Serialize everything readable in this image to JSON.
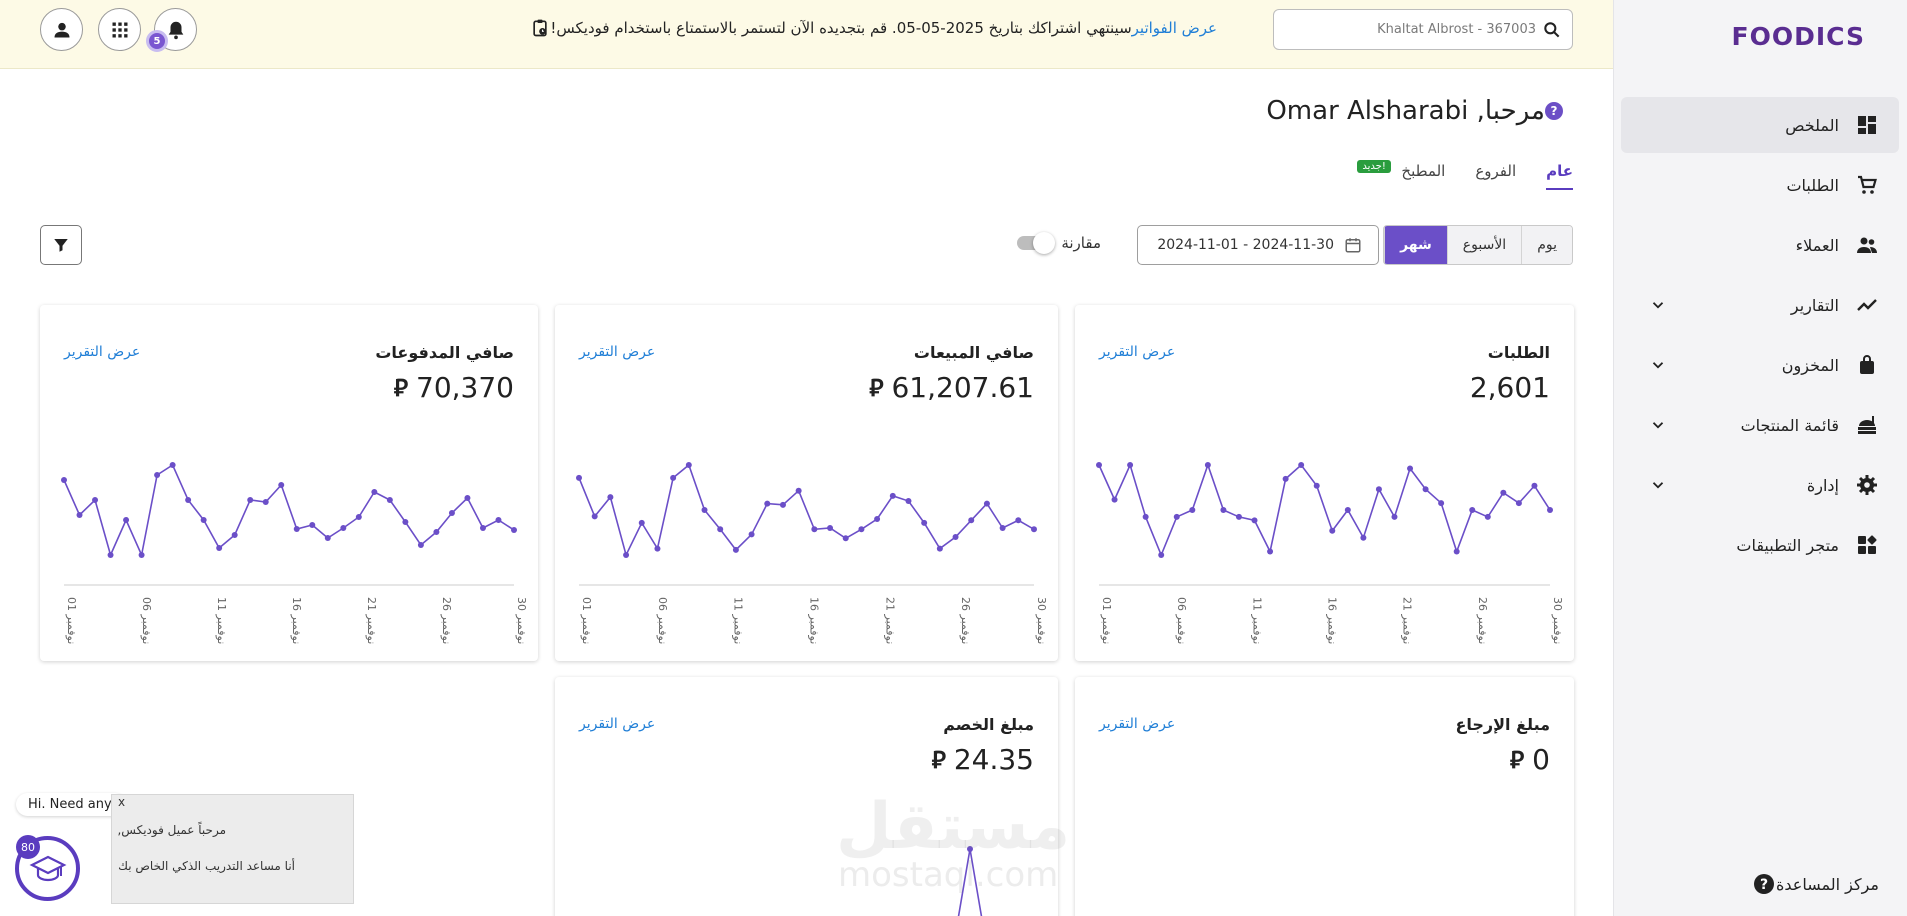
{
  "brand": {
    "logo_text": "FOODICS",
    "accent": "#6b4fc8",
    "link": "#1f7ed6"
  },
  "sidebar": {
    "items": [
      {
        "label": "الملخص",
        "icon": "dashboard-icon",
        "active": true,
        "expandable": false
      },
      {
        "label": "الطلبات",
        "icon": "cart-icon",
        "active": false,
        "expandable": false
      },
      {
        "label": "العملاء",
        "icon": "users-icon",
        "active": false,
        "expandable": false
      },
      {
        "label": "التقارير",
        "icon": "trend-icon",
        "active": false,
        "expandable": true
      },
      {
        "label": "المخزون",
        "icon": "bag-icon",
        "active": false,
        "expandable": true
      },
      {
        "label": "قائمة المنتجات",
        "icon": "food-icon",
        "active": false,
        "expandable": true
      },
      {
        "label": "إدارة",
        "icon": "gear-icon",
        "active": false,
        "expandable": true
      },
      {
        "label": "متجر التطبيقات",
        "icon": "apps-store-icon",
        "active": false,
        "expandable": false
      }
    ],
    "help_center": "مركز المساعدة"
  },
  "topbar": {
    "search_value": "Khaltat Albrost - 367003",
    "notice": "سينتهي اشتراكك بتاريخ 2025-05-05. قم بتجديده الآن لتستمر بالاستمتاع باستخدام فوديكس!",
    "notice_link": "عرض الفواتير",
    "notifications_count": "5"
  },
  "main": {
    "greeting": "مرحبا, Omar Alsharabi",
    "tabs": [
      {
        "label": "عام",
        "active": true
      },
      {
        "label": "الفروع",
        "active": false
      },
      {
        "label": "المطبخ",
        "active": false,
        "badge": "جديد!"
      }
    ],
    "period": {
      "day": "يوم",
      "week": "الأسبوع",
      "month": "شهر",
      "selected": "month"
    },
    "date_range": "2024-11-01 - 2024-11-30",
    "compare_label": "مقارنة",
    "currency_symbol": "⃁",
    "x_ticks": [
      "01 نوفمبر",
      "06 نوفمبر",
      "11 نوفمبر",
      "16 نوفمبر",
      "21 نوفمبر",
      "26 نوفمبر",
      "30 نوفمبر"
    ],
    "view_report": "عرض التقرير",
    "cards": [
      {
        "title": "الطلبات",
        "value": "2,601",
        "currency": false
      },
      {
        "title": "صافي المبيعات",
        "value": "61,207.61",
        "currency": true
      },
      {
        "title": "صافي المدفوعات",
        "value": "70,370",
        "currency": true
      },
      {
        "title": "مبلغ الإرجاع",
        "value": "0",
        "currency": true
      },
      {
        "title": "مبلغ الخصم",
        "value": "24.35",
        "currency": true
      }
    ]
  },
  "chart_data": [
    {
      "type": "line",
      "title": "الطلبات",
      "x": [
        "01",
        "02",
        "03",
        "04",
        "05",
        "06",
        "07",
        "08",
        "09",
        "10",
        "11",
        "12",
        "13",
        "14",
        "15",
        "16",
        "17",
        "18",
        "19",
        "20",
        "21",
        "22",
        "23",
        "24",
        "25",
        "26",
        "27",
        "28",
        "29",
        "30"
      ],
      "values": [
        95,
        85,
        95,
        80,
        69,
        80,
        82,
        95,
        82,
        80,
        79,
        70,
        91,
        95,
        89,
        76,
        82,
        74,
        88,
        80,
        94,
        88,
        84,
        70,
        82,
        80,
        87,
        84,
        89,
        82
      ]
    },
    {
      "type": "line",
      "title": "صافي المبيعات",
      "x": [
        "01",
        "02",
        "03",
        "04",
        "05",
        "06",
        "07",
        "08",
        "09",
        "10",
        "11",
        "12",
        "13",
        "14",
        "15",
        "16",
        "17",
        "18",
        "19",
        "20",
        "21",
        "22",
        "23",
        "24",
        "25",
        "26",
        "27",
        "28",
        "29",
        "30"
      ],
      "values": [
        2200,
        1900,
        2050,
        1600,
        1850,
        1650,
        2200,
        2300,
        1950,
        1800,
        1640,
        1760,
        2000,
        1990,
        2100,
        1800,
        1810,
        1730,
        1800,
        1880,
        2060,
        2020,
        1850,
        1650,
        1740,
        1870,
        2000,
        1810,
        1870,
        1800
      ]
    },
    {
      "type": "line",
      "title": "صافي المدفوعات",
      "x": [
        "01",
        "02",
        "03",
        "04",
        "05",
        "06",
        "07",
        "08",
        "09",
        "10",
        "11",
        "12",
        "13",
        "14",
        "15",
        "16",
        "17",
        "18",
        "19",
        "20",
        "21",
        "22",
        "23",
        "24",
        "25",
        "26",
        "27",
        "28",
        "29",
        "30"
      ],
      "values": [
        2600,
        2250,
        2400,
        1850,
        2200,
        1850,
        2650,
        2750,
        2400,
        2200,
        1920,
        2050,
        2400,
        2380,
        2550,
        2110,
        2150,
        2020,
        2120,
        2230,
        2480,
        2400,
        2180,
        1950,
        2080,
        2270,
        2420,
        2120,
        2200,
        2100
      ]
    }
  ],
  "chat": {
    "pill": "Hi. Need any help?",
    "line1": "مرحباً عميل فوديكس,",
    "line2": "أنا مساعد التدريب الذكي الخاص بك",
    "count": "80",
    "close": "x"
  },
  "watermark": {
    "ar": "مستقل",
    "en": "mostaql.com"
  }
}
